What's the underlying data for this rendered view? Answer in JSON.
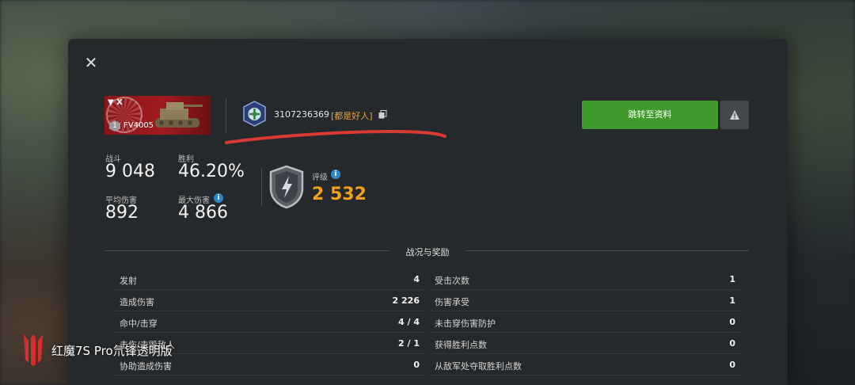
{
  "tank": {
    "nation_marker": "▼ X",
    "tier": "1",
    "name": "FV4005"
  },
  "player": {
    "id": "3107236369",
    "clan_tag": "[都是好人]"
  },
  "buttons": {
    "close": "✕",
    "go_to_profile": "跳转至资料"
  },
  "summary": {
    "battles_label": "战斗",
    "battles_value": "9 048",
    "wins_label": "胜利",
    "wins_value": "46.20%",
    "avg_damage_label": "平均伤害",
    "avg_damage_value": "892",
    "max_damage_label": "最大伤害",
    "max_damage_value": "4 866",
    "rating_label": "评级",
    "rating_value": "2 532"
  },
  "section": {
    "title": "战况与奖励"
  },
  "left_stats": [
    {
      "label": "发射",
      "value": "4"
    },
    {
      "label": "造成伤害",
      "value": "2 226"
    },
    {
      "label": "命中/击穿",
      "value": "4 / 4"
    },
    {
      "label": "击伤/击毁敌人",
      "value": "2 / 1"
    },
    {
      "label": "协助造成伤害",
      "value": "0"
    }
  ],
  "right_stats": [
    {
      "label": "受击次数",
      "value": "1"
    },
    {
      "label": "伤害承受",
      "value": "1"
    },
    {
      "label": "未击穿伤害防护",
      "value": "0"
    },
    {
      "label": "获得胜利点数",
      "value": "0"
    },
    {
      "label": "从敌军处夺取胜利点数",
      "value": "0"
    }
  ],
  "watermark": {
    "text": "红魔7S Pro氘锋透明版"
  },
  "colors": {
    "accent_green": "#3f9a2b",
    "rating_orange": "#f0a020",
    "clan_tag_orange": "#e8a43a",
    "annotation_red": "#d83a34",
    "info_blue": "#2f86c9"
  },
  "icons": {
    "close": "close-icon",
    "copy": "copy-icon",
    "warning": "warning-icon",
    "info": "info-icon",
    "clan": "clan-emblem-icon",
    "rating": "rating-shield-icon"
  }
}
